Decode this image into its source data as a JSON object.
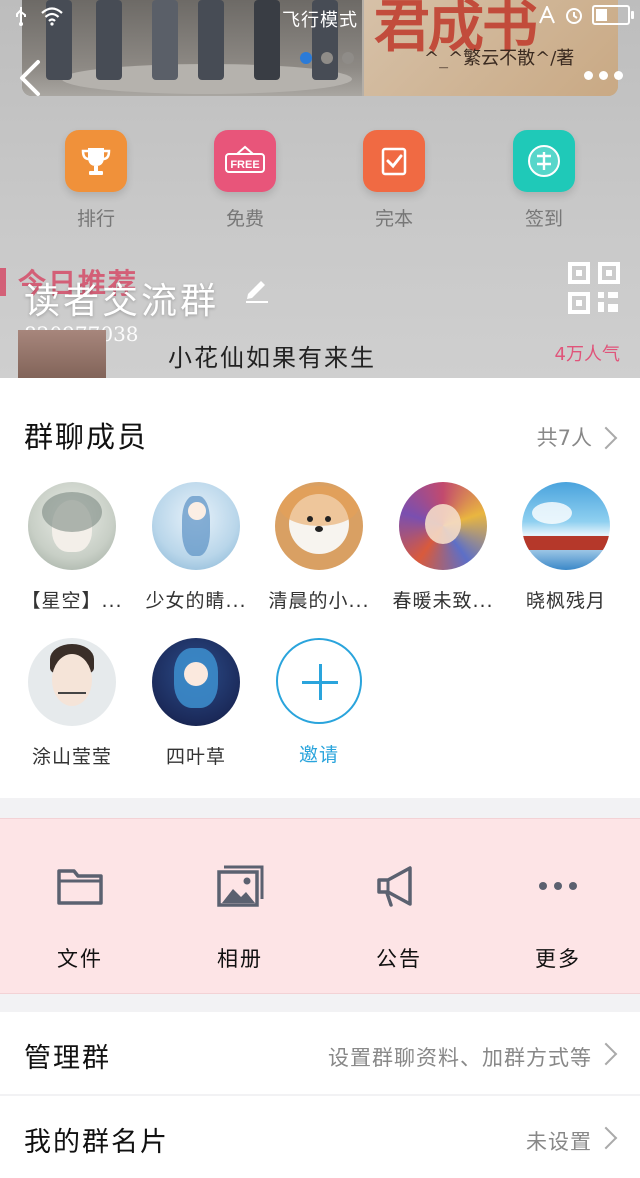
{
  "status_bar": {
    "mode": "飞行模式",
    "mode_icon": "airplane-icon",
    "wifi_icon": "wifi-icon",
    "battery_level": 0.35
  },
  "banner": {
    "promo_title": "君成书",
    "promo_sub": "^_^繁云不散^/著",
    "slide_index": 1,
    "slide_count": 3
  },
  "quick_actions": [
    {
      "label": "排行",
      "icon": "trophy-icon",
      "color": "#f0913a"
    },
    {
      "label": "免费",
      "icon": "free-tag-icon",
      "color": "#e8557a"
    },
    {
      "label": "完本",
      "icon": "check-book-icon",
      "color": "#f06a43"
    },
    {
      "label": "签到",
      "icon": "sign-in-icon",
      "color": "#1fc9b8"
    }
  ],
  "header": {
    "today_label": "今日推荐",
    "group_name": "读者交流群",
    "group_id": "820977038",
    "book_title": "小花仙如果有来生",
    "popularity": "4万人气"
  },
  "members_section": {
    "title": "群聊成员",
    "count_label": "共7人",
    "members": [
      {
        "name": "【星空】..."
      },
      {
        "name": "少女的睛..."
      },
      {
        "name": "清晨的小..."
      },
      {
        "name": "春暖未致..."
      },
      {
        "name": "晓枫残月"
      },
      {
        "name": "涂山莹莹"
      },
      {
        "name": "四叶草"
      }
    ],
    "invite_label": "邀请"
  },
  "tools": [
    {
      "label": "文件",
      "icon": "folder-icon"
    },
    {
      "label": "相册",
      "icon": "album-icon"
    },
    {
      "label": "公告",
      "icon": "megaphone-icon"
    },
    {
      "label": "更多",
      "icon": "more-dots-icon"
    }
  ],
  "settings": [
    {
      "label": "管理群",
      "value": "设置群聊资料、加群方式等"
    },
    {
      "label": "我的群名片",
      "value": "未设置"
    }
  ],
  "colors": {
    "accent": "#2aa4dc",
    "tools_bg": "#fde4e6",
    "popularity": "#e0547a"
  }
}
